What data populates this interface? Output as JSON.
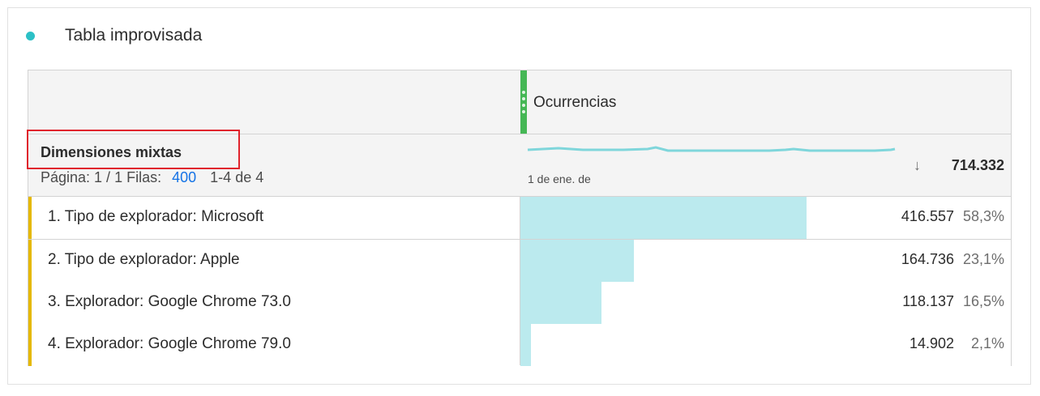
{
  "panel": {
    "title": "Tabla improvisada",
    "dot_color": "#2cc0c6"
  },
  "table": {
    "metric": {
      "name": "Ocurrencias",
      "handle_color": "#45b755"
    },
    "dimension": {
      "name": "Dimensiones mixtas",
      "pager_label": "Página: 1 / 1 Filas:",
      "rows_per_page": "400",
      "range": "1-4 de 4"
    },
    "sparkline_date": "1 de ene. de",
    "sort_icon": "arrow-down-icon",
    "total": "714.332",
    "rows": [
      {
        "label": "1. Tipo de explorador: Microsoft",
        "value": "416.557",
        "percent": "58,3%",
        "share": 0.583
      },
      {
        "label": "2. Tipo de explorador: Apple",
        "value": "164.736",
        "percent": "23,1%",
        "share": 0.231
      },
      {
        "label": "3. Explorador: Google Chrome 73.0",
        "value": "118.137",
        "percent": "16,5%",
        "share": 0.165
      },
      {
        "label": "4. Explorador: Google Chrome 79.0",
        "value": "14.902",
        "percent": "2,1%",
        "share": 0.021
      }
    ],
    "colors": {
      "bar": "#bbeaee",
      "row_accent": "#e5b800",
      "highlight_box": "#e0242c",
      "sparkline": "#7fd6db"
    }
  }
}
